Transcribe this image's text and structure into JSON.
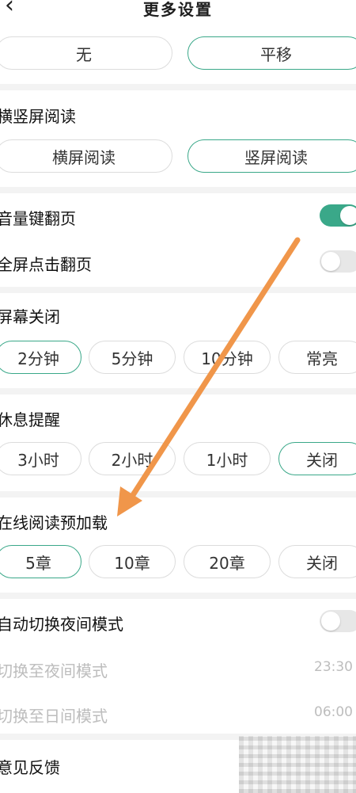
{
  "header": {
    "title": "更多设置",
    "back_icon": "chevron-left-icon"
  },
  "flip_effect": {
    "options": [
      "无",
      "平移"
    ],
    "selected": "平移"
  },
  "orientation": {
    "label": "横竖屏阅读",
    "options": [
      "横屏阅读",
      "竖屏阅读"
    ],
    "selected": "竖屏阅读"
  },
  "volume_flip": {
    "label": "音量键翻页",
    "on": true
  },
  "fullscreen_flip": {
    "label": "全屏点击翻页",
    "on": false
  },
  "screen_off": {
    "label": "屏幕关闭",
    "options": [
      "2分钟",
      "5分钟",
      "10分钟",
      "常亮"
    ],
    "selected": "2分钟"
  },
  "rest_reminder": {
    "label": "休息提醒",
    "options": [
      "3小时",
      "2小时",
      "1小时",
      "关闭"
    ],
    "selected": "关闭"
  },
  "preload": {
    "label": "在线阅读预加载",
    "options": [
      "5章",
      "10章",
      "20章",
      "关闭"
    ],
    "selected": "5章"
  },
  "auto_night": {
    "label": "自动切换夜间模式",
    "on": false,
    "to_night_label": "切换至夜间模式",
    "to_night_time": "23:30",
    "to_day_label": "切换至日间模式",
    "to_day_time": "06:00"
  },
  "feedback": {
    "label": "意见反馈"
  },
  "colors": {
    "accent": "#3aa889",
    "annotation_arrow": "#f0964a"
  }
}
